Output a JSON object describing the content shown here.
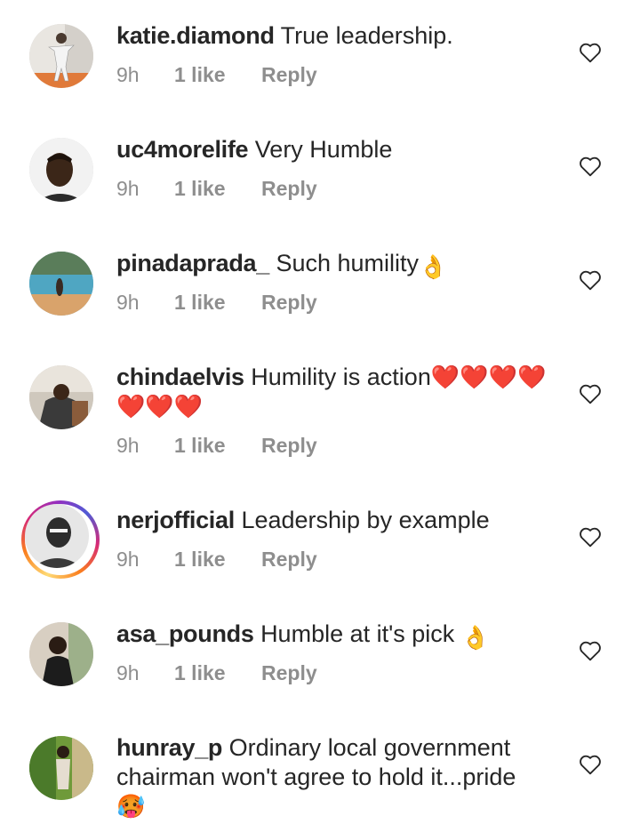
{
  "comments": [
    {
      "username": "katie.diamond",
      "text": "True leadership.",
      "emoji": "",
      "time": "9h",
      "likes": "1 like",
      "reply": "Reply"
    },
    {
      "username": "uc4morelife",
      "text": "Very Humble",
      "emoji": "",
      "time": "9h",
      "likes": "1 like",
      "reply": "Reply"
    },
    {
      "username": "pinadaprada_",
      "text": "Such humility",
      "emoji": "👌",
      "time": "9h",
      "likes": "1 like",
      "reply": "Reply"
    },
    {
      "username": "chindaelvis",
      "text": "Humility is action",
      "emoji": "❤️❤️❤️❤️❤️❤️❤️",
      "time": "9h",
      "likes": "1 like",
      "reply": "Reply"
    },
    {
      "username": "nerjofficial",
      "text": "Leadership by example",
      "emoji": "",
      "time": "9h",
      "likes": "1 like",
      "reply": "Reply"
    },
    {
      "username": "asa_pounds",
      "text": "Humble at it's pick",
      "emoji": "👌",
      "time": "9h",
      "likes": "1 like",
      "reply": "Reply"
    },
    {
      "username": "hunray_p",
      "text": "Ordinary local government chairman won't agree to hold it...pride",
      "emoji": "🥵",
      "time": "",
      "likes": "",
      "reply": ""
    }
  ],
  "icons": {
    "like": "heart-outline-icon",
    "ok_hand": "ok-hand-emoji",
    "red_heart": "red-heart-emoji",
    "hot_face": "hot-face-emoji"
  },
  "colors": {
    "text": "#262626",
    "meta": "#8e8e8e",
    "heart_emoji": "#e0142b",
    "ok_hand": "#f5b921"
  }
}
